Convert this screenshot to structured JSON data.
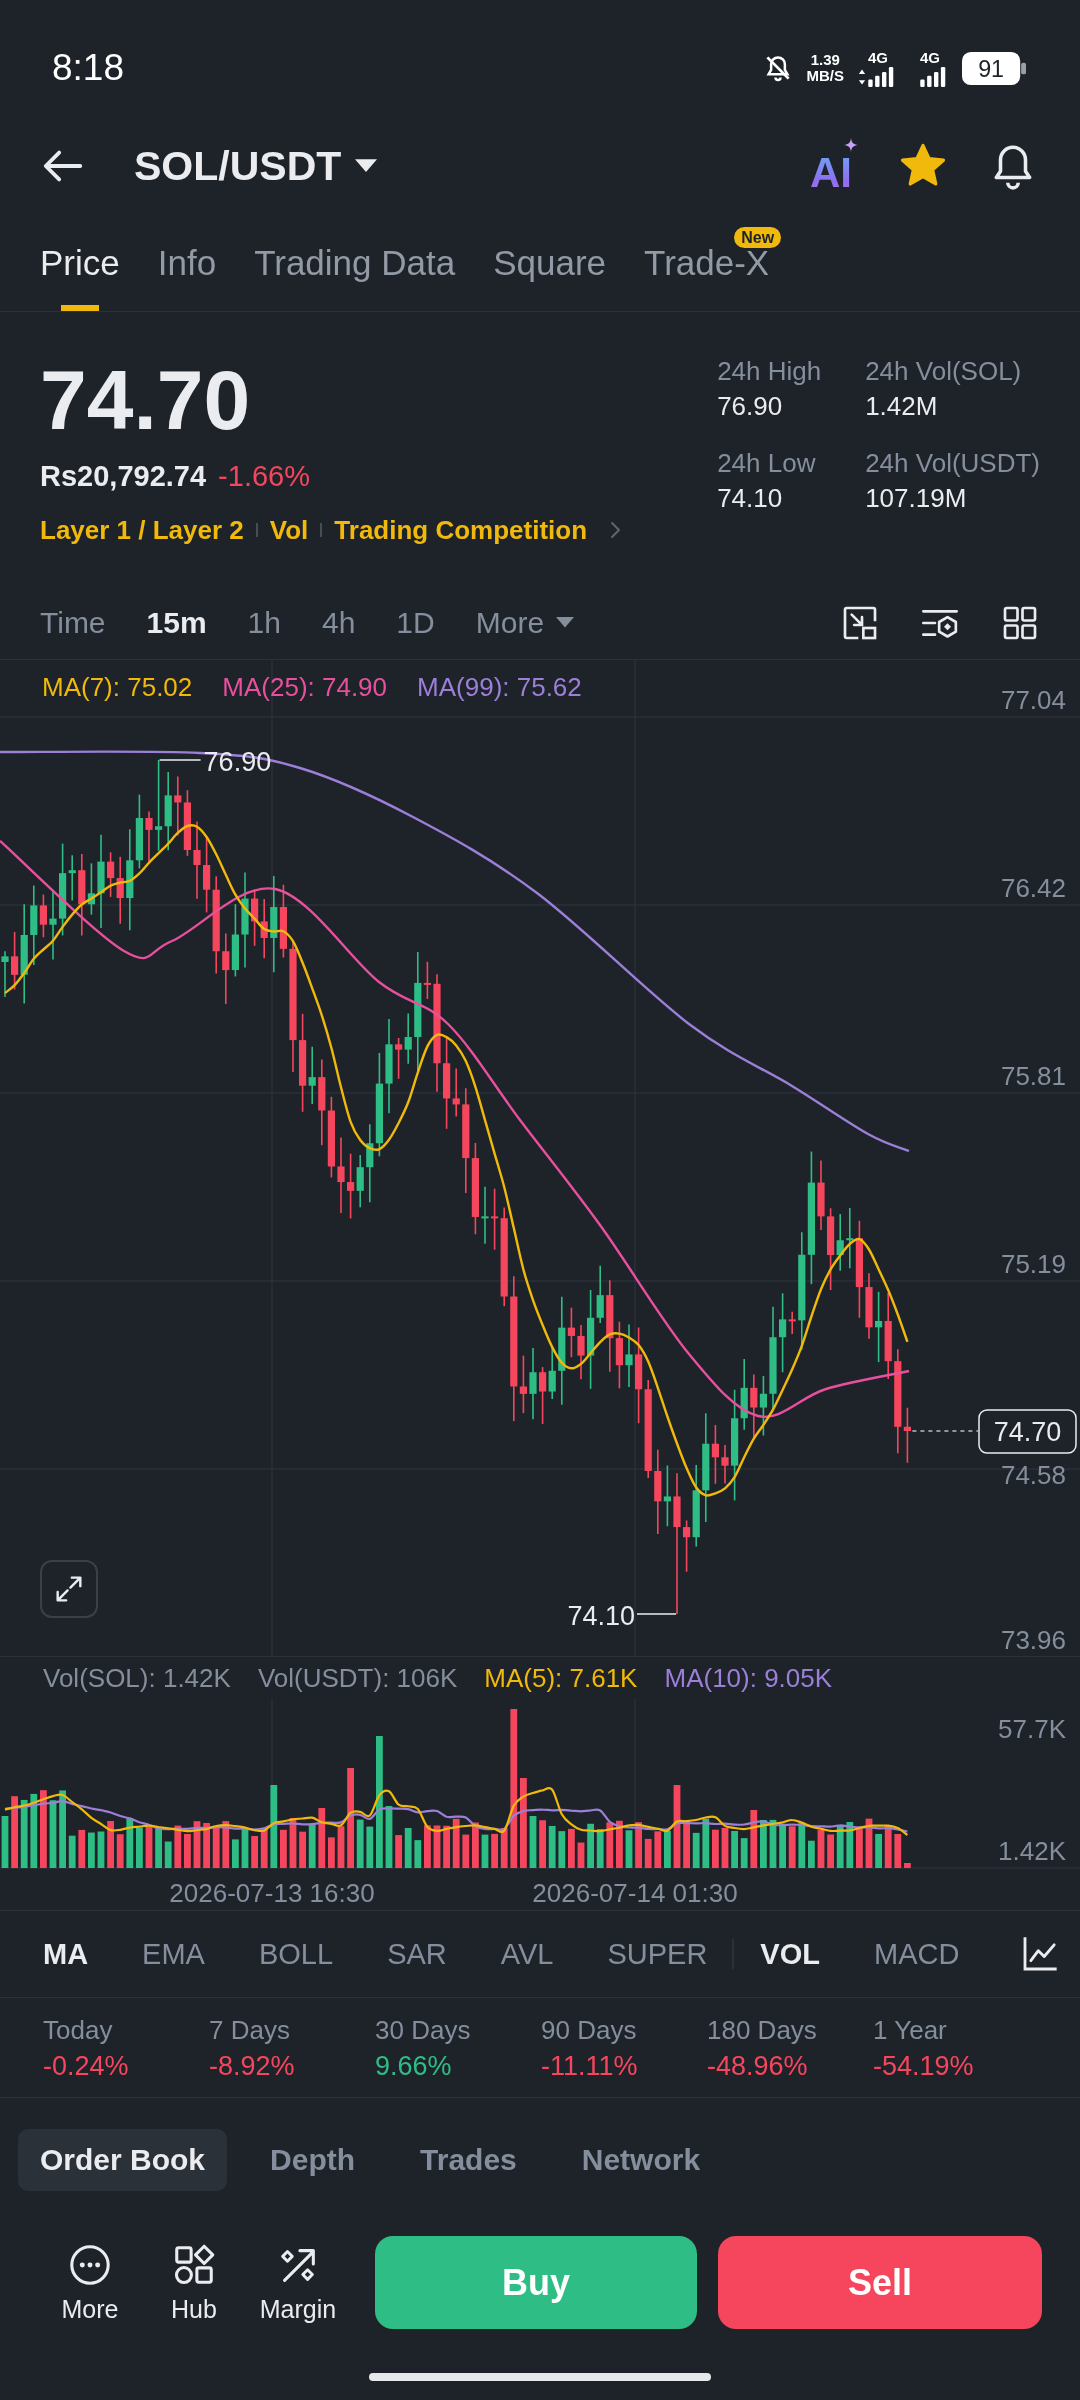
{
  "status_bar": {
    "time": "8:18",
    "net_speed": "1.39",
    "net_speed_unit": "MB/S",
    "networks": [
      "4G",
      "4G"
    ],
    "battery": "91"
  },
  "header": {
    "pair": "SOL/USDT",
    "ai_label": "AI",
    "favorite": true
  },
  "tabs": [
    {
      "label": "Price",
      "selected": true
    },
    {
      "label": "Info",
      "selected": false
    },
    {
      "label": "Trading Data",
      "selected": false
    },
    {
      "label": "Square",
      "selected": false
    },
    {
      "label": "Trade-X",
      "selected": false,
      "badge": "New"
    }
  ],
  "price": {
    "last": "74.70",
    "fiat": "Rs20,792.74",
    "change": "-1.66%",
    "up": false
  },
  "tags": [
    "Layer 1 / Layer 2",
    "Vol",
    "Trading Competition"
  ],
  "stats": [
    {
      "label": "24h High",
      "value": "76.90"
    },
    {
      "label": "24h Vol(SOL)",
      "value": "1.42M"
    },
    {
      "label": "24h Low",
      "value": "74.10"
    },
    {
      "label": "24h Vol(USDT)",
      "value": "107.19M"
    }
  ],
  "intervals": [
    {
      "label": "Time",
      "selected": false
    },
    {
      "label": "15m",
      "selected": true
    },
    {
      "label": "1h",
      "selected": false
    },
    {
      "label": "4h",
      "selected": false
    },
    {
      "label": "1D",
      "selected": false
    }
  ],
  "more_intervals": "More",
  "price_chart": {
    "legend": [
      {
        "label": "MA(7): 75.02",
        "color": "#f0b90b"
      },
      {
        "label": "MA(25): 74.90",
        "color": "#e8509e"
      },
      {
        "label": "MA(99): 75.62",
        "color": "#9b7fd8"
      }
    ],
    "axis_labels": [
      "77.04",
      "76.42",
      "75.81",
      "75.19",
      "74.58",
      "73.96"
    ],
    "high_label": "76.90",
    "low_label": "74.10",
    "last_price": "74.70"
  },
  "volume": {
    "legend": [
      {
        "label": "Vol(SOL): 1.42K",
        "color": "#848e9c"
      },
      {
        "label": "Vol(USDT): 106K",
        "color": "#848e9c"
      },
      {
        "label": "MA(5): 7.61K",
        "color": "#f0b90b"
      },
      {
        "label": "MA(10): 9.05K",
        "color": "#9b7fd8"
      }
    ],
    "axis_labels": [
      "57.7K",
      "1.42K"
    ],
    "dates": [
      "2026-07-13 16:30",
      "2026-07-14 01:30"
    ]
  },
  "main_indicators": [
    {
      "label": "MA",
      "selected": true
    },
    {
      "label": "EMA",
      "selected": false
    },
    {
      "label": "BOLL",
      "selected": false
    },
    {
      "label": "SAR",
      "selected": false
    },
    {
      "label": "AVL",
      "selected": false
    },
    {
      "label": "SUPER",
      "selected": false
    }
  ],
  "sub_indicators": [
    {
      "label": "VOL",
      "selected": true
    },
    {
      "label": "MACD",
      "selected": false
    }
  ],
  "periods": [
    {
      "label": "Today",
      "value": "-0.24%",
      "up": false
    },
    {
      "label": "7 Days",
      "value": "-8.92%",
      "up": false
    },
    {
      "label": "30 Days",
      "value": "9.66%",
      "up": true
    },
    {
      "label": "90 Days",
      "value": "-11.11%",
      "up": false
    },
    {
      "label": "180 Days",
      "value": "-48.96%",
      "up": false
    },
    {
      "label": "1 Year",
      "value": "-54.19%",
      "up": false
    }
  ],
  "sections": [
    {
      "label": "Order Book",
      "selected": true
    },
    {
      "label": "Depth",
      "selected": false
    },
    {
      "label": "Trades",
      "selected": false
    },
    {
      "label": "Network",
      "selected": false
    }
  ],
  "bottom_bar": {
    "actions": [
      "More",
      "Hub",
      "Margin"
    ],
    "buy": "Buy",
    "sell": "Sell"
  }
}
